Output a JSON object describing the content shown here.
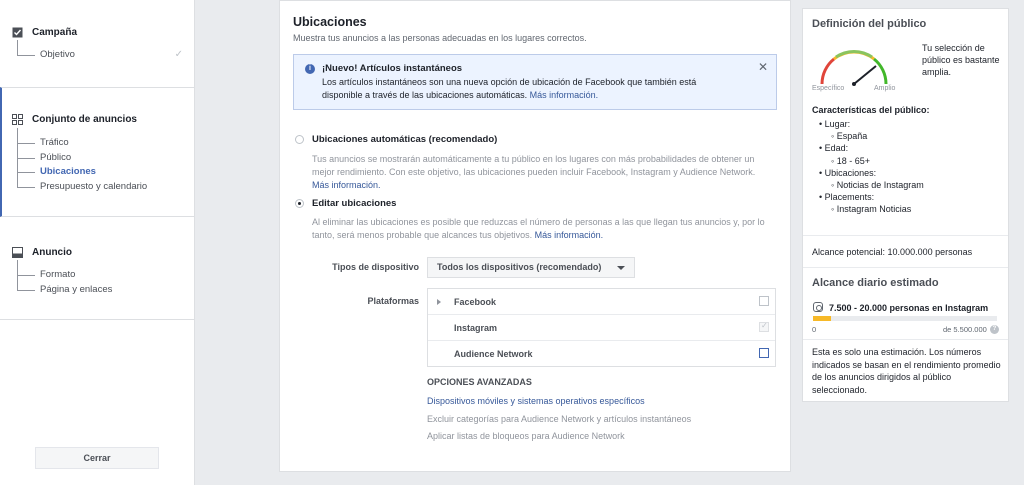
{
  "sidebar": {
    "campaign": {
      "label": "Campaña",
      "items": [
        "Objetivo"
      ]
    },
    "adset": {
      "label": "Conjunto de anuncios",
      "items": [
        "Tráfico",
        "Público",
        "Ubicaciones",
        "Presupuesto y calendario"
      ],
      "active": "Ubicaciones"
    },
    "ad": {
      "label": "Anuncio",
      "items": [
        "Formato",
        "Página y enlaces"
      ]
    },
    "close_label": "Cerrar"
  },
  "main": {
    "title": "Ubicaciones",
    "subtitle": "Muestra tus anuncios a las personas adecuadas en los lugares correctos.",
    "notice": {
      "title": "¡Nuevo! Artículos instantáneos",
      "body": "Los artículos instantáneos son una nueva opción de ubicación de Facebook que también está disponible a través de las ubicaciones automáticas.",
      "link": "Más información."
    },
    "auto": {
      "label": "Ubicaciones automáticas (recomendado)",
      "desc": "Tus anuncios se mostrarán automáticamente a tu público en los lugares con más probabilidades de obtener un mejor rendimiento. Con este objetivo, las ubicaciones pueden incluir Facebook, Instagram y Audience Network.",
      "link": "Más información."
    },
    "edit": {
      "label": "Editar ubicaciones",
      "desc": "Al eliminar las ubicaciones es posible que reduzcas el número de personas a las que llegan tus anuncios y, por lo tanto, será menos probable que alcances tus objetivos.",
      "link": "Más información."
    },
    "device_label": "Tipos de dispositivo",
    "device_value": "Todos los dispositivos (recomendado)",
    "platforms_label": "Plataformas",
    "platforms": [
      "Facebook",
      "Instagram",
      "Audience Network"
    ],
    "advanced": {
      "title": "OPCIONES AVANZADAS",
      "items": [
        "Dispositivos móviles y sistemas operativos específicos",
        "Excluir categorías para Audience Network y artículos instantáneos",
        "Aplicar listas de bloqueos para Audience Network"
      ]
    }
  },
  "audience": {
    "title": "Definición del público",
    "gauge_note": "Tu selección de público es bastante amplia.",
    "gauge_left": "Específico",
    "gauge_right": "Amplio",
    "chars_title": "Características del público:",
    "place_k": "Lugar:",
    "place_v": "España",
    "age_k": "Edad:",
    "age_v": "18 - 65+",
    "loc_k": "Ubicaciones:",
    "loc_v": "Noticias de Instagram",
    "plc_k": "Placements:",
    "plc_v": "Instagram Noticias",
    "reach": "Alcance potencial: 10.000.000 personas",
    "daily_title": "Alcance diario estimado",
    "daily_value": "7.500 - 20.000 personas en Instagram",
    "bar_min": "0",
    "bar_max": "de 5.500.000",
    "bar_fraction": 0.1,
    "estimate": "Esta es solo una estimación. Los números indicados se basan en el rendimiento promedio de los anuncios dirigidos al público seleccionado."
  }
}
